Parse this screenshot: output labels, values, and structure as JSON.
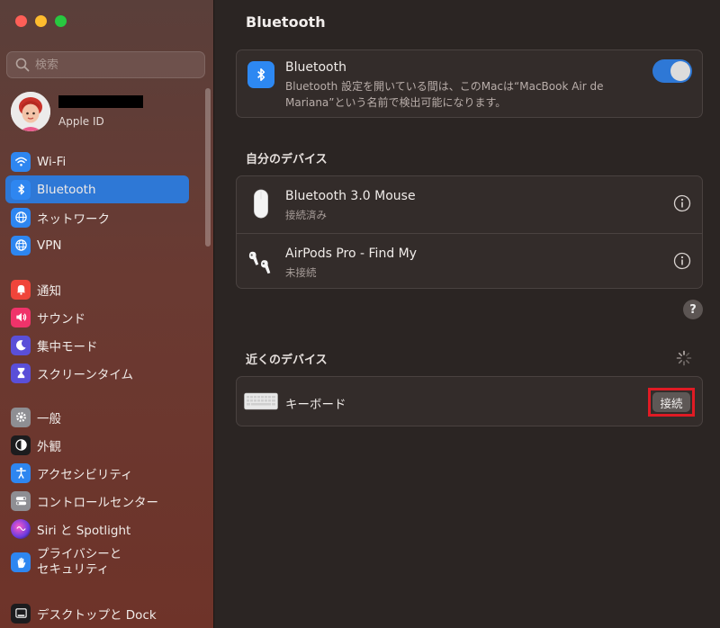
{
  "window": {
    "title": "Bluetooth"
  },
  "sidebar": {
    "search_placeholder": "検索",
    "account": {
      "subtitle": "Apple ID"
    },
    "groups": [
      [
        {
          "label": "Wi-Fi",
          "icon": "wifi-icon",
          "color": "#2e86f0",
          "active": false
        },
        {
          "label": "Bluetooth",
          "icon": "bluetooth-icon",
          "color": "#2e86f0",
          "active": true
        },
        {
          "label": "ネットワーク",
          "icon": "globe-icon",
          "color": "#2e86f0",
          "active": false
        },
        {
          "label": "VPN",
          "icon": "vpn-globe-icon",
          "color": "#2e86f0",
          "active": false
        }
      ],
      [
        {
          "label": "通知",
          "icon": "bell-icon",
          "color": "#f0453a",
          "active": false
        },
        {
          "label": "サウンド",
          "icon": "speaker-icon",
          "color": "#f0336a",
          "active": false
        },
        {
          "label": "集中モード",
          "icon": "moon-icon",
          "color": "#5a4fd8",
          "active": false
        },
        {
          "label": "スクリーンタイム",
          "icon": "hourglass-icon",
          "color": "#5a4fd8",
          "active": false
        }
      ],
      [
        {
          "label": "一般",
          "icon": "gear-icon",
          "color": "#8e8e93",
          "active": false
        },
        {
          "label": "外観",
          "icon": "appearance-icon",
          "color": "#1c1c1e",
          "active": false
        },
        {
          "label": "アクセシビリティ",
          "icon": "accessibility-icon",
          "color": "#2e86f0",
          "active": false
        },
        {
          "label": "コントロールセンター",
          "icon": "switches-icon",
          "color": "#8e8e93",
          "active": false
        },
        {
          "label": "Siri と Spotlight",
          "icon": "siri-icon",
          "color": "#b43aa8",
          "active": false
        },
        {
          "label": "プライバシーと\nセキュリティ",
          "label_line1": "プライバシーと",
          "label_line2": "セキュリティ",
          "icon": "hand-icon",
          "color": "#2e86f0",
          "active": false
        }
      ],
      [
        {
          "label": "デスクトップと Dock",
          "icon": "dock-icon",
          "color": "#1c1c1e",
          "active": false
        }
      ]
    ]
  },
  "main": {
    "title": "Bluetooth",
    "bluetooth_card": {
      "title": "Bluetooth",
      "description": "Bluetooth 設定を開いている間は、このMacは“MacBook Air de Mariana”という名前で検出可能になります。",
      "toggle_on": true
    },
    "my_devices": {
      "heading": "自分のデバイス",
      "items": [
        {
          "name": "Bluetooth 3.0 Mouse",
          "status": "接続済み",
          "icon": "mouse-icon"
        },
        {
          "name": "AirPods Pro - Find My",
          "status": "未接続",
          "icon": "airpods-icon"
        }
      ]
    },
    "nearby": {
      "heading": "近くのデバイス",
      "items": [
        {
          "name": "キーボード",
          "icon": "keyboard-icon",
          "action": "接続"
        }
      ]
    },
    "help_label": "?"
  },
  "colors": {
    "accent": "#2e78d6",
    "highlight": "#e01b24"
  }
}
